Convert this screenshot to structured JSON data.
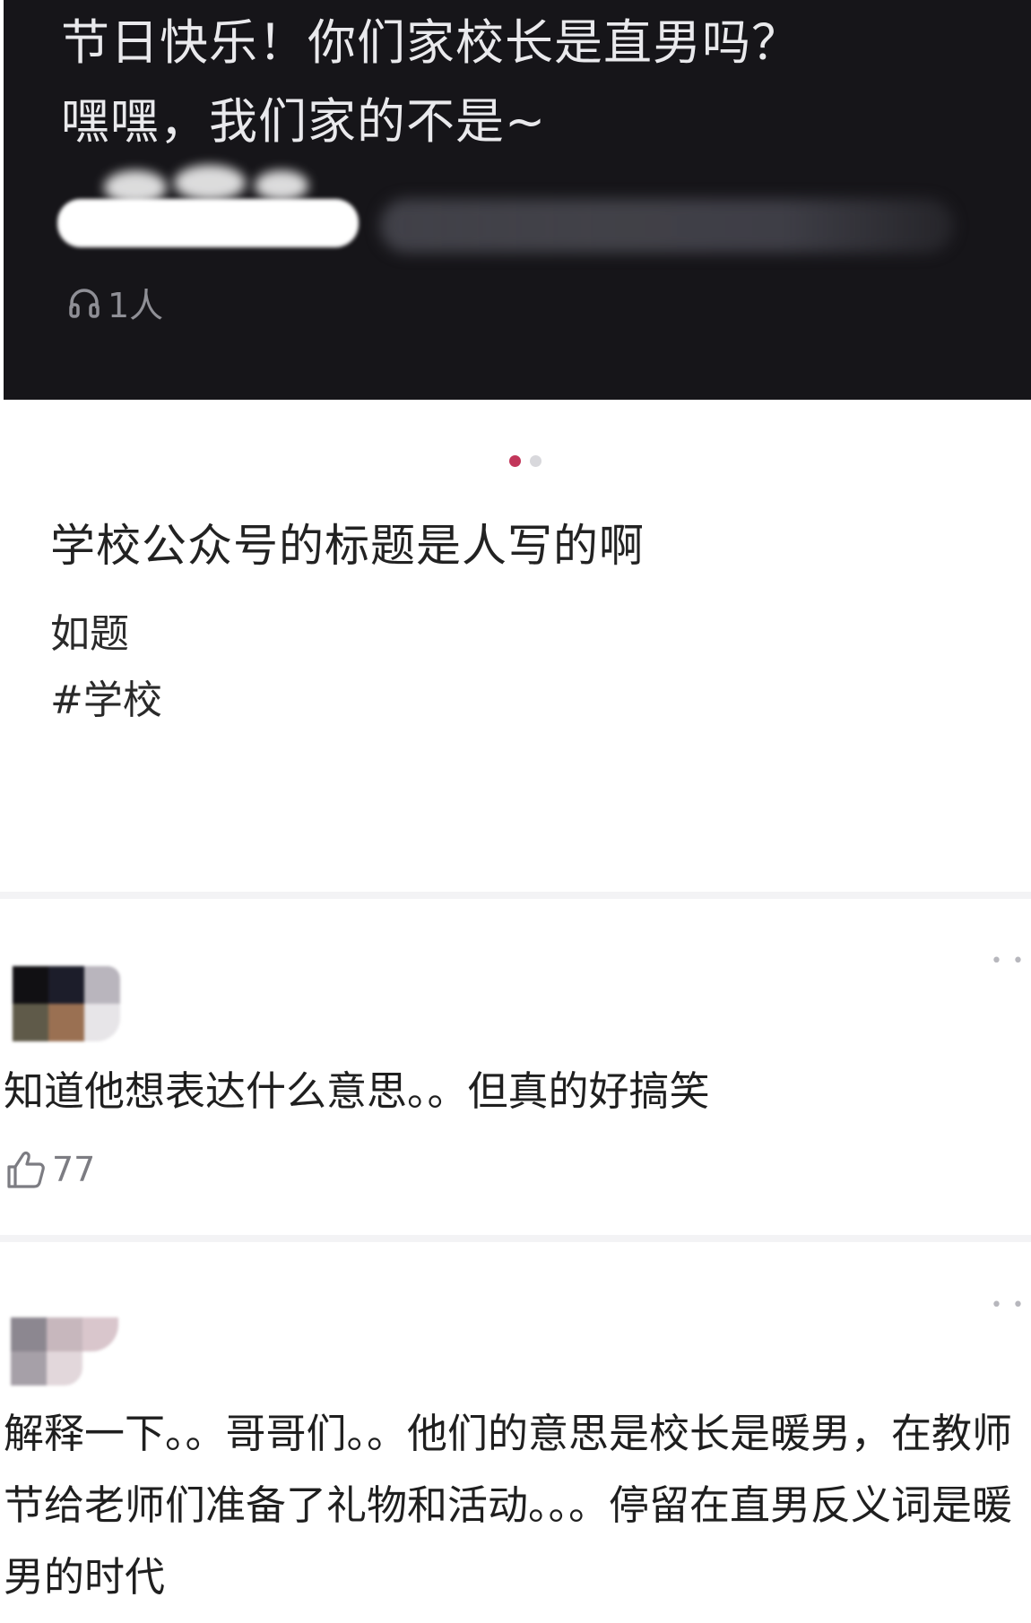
{
  "banner": {
    "title_line1": "节日快乐！你们家校长是直男吗？",
    "title_line2": "嘿嘿，我们家的不是~",
    "listener_count": "1人"
  },
  "carousel": {
    "total": 2,
    "active": 1
  },
  "post": {
    "title": "学校公众号的标题是人写的啊",
    "description": "如题",
    "tag": "#学校"
  },
  "comments": [
    {
      "text": "知道他想表达什么意思。。但真的好搞笑",
      "likes": "77"
    },
    {
      "text": "解释一下。。哥哥们。。他们的意思是校长是暖男，在教师节给老师们准备了礼物和活动。。。停留在直男反义词是暖男的时代"
    }
  ],
  "icons": {
    "listener": "headphone-icon",
    "like": "thumbs-up-icon",
    "more": "more-dots-icon"
  },
  "colors": {
    "banner_bg": "#161519",
    "accent_dot": "#c2365a"
  }
}
